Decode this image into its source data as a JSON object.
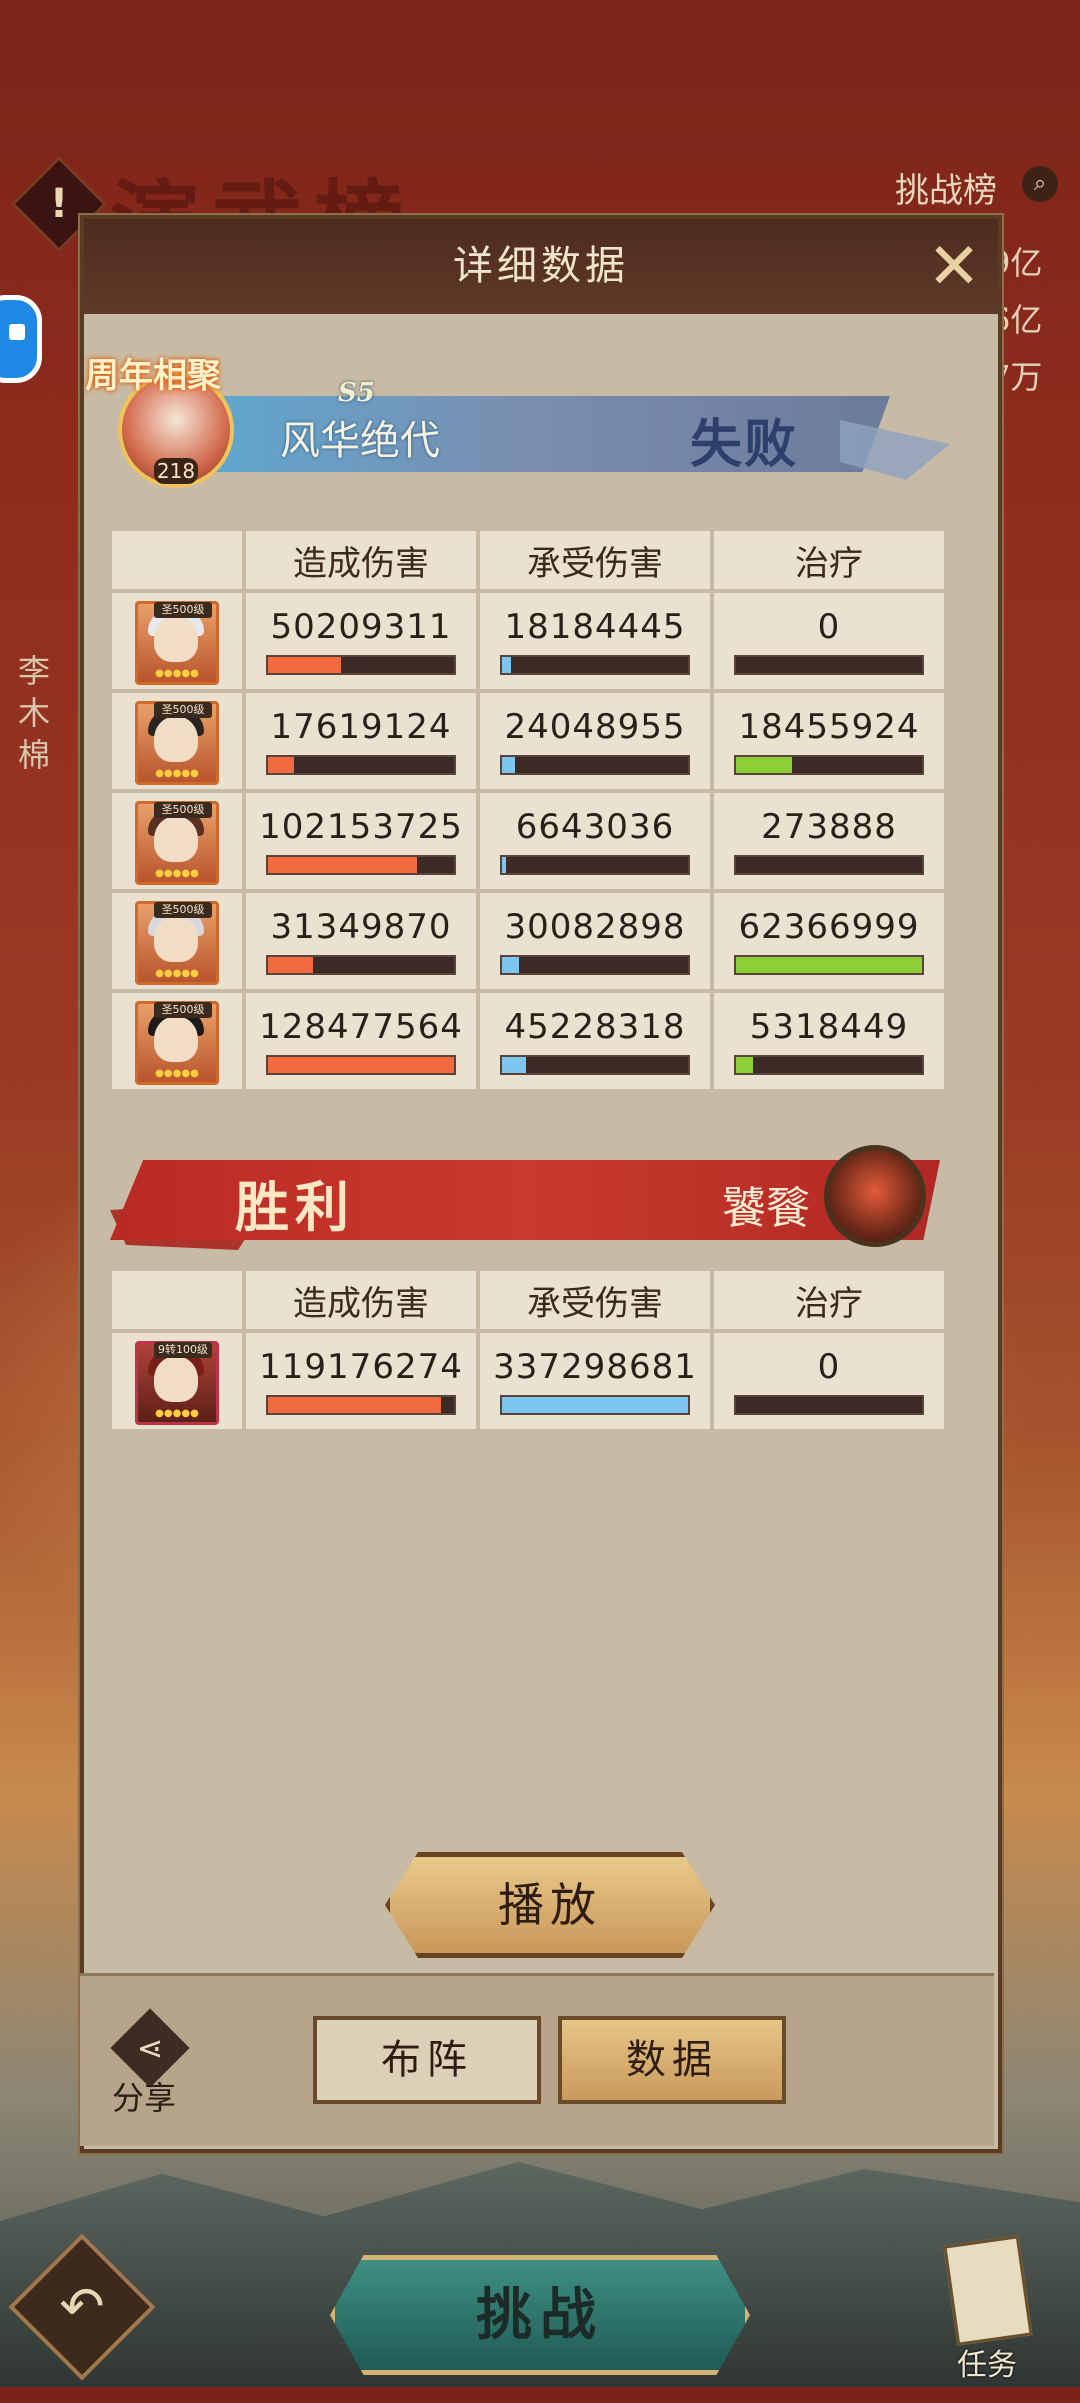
{
  "background": {
    "title": "演武榜",
    "rank_link": "挑战榜",
    "side_values": [
      "9亿",
      "6亿",
      "7万"
    ],
    "side_name": "李木棉",
    "challenge_button": "挑战",
    "task_label": "任务"
  },
  "dialog": {
    "title": "详细数据",
    "close_icon": "close-icon"
  },
  "team1": {
    "badge": "周年相聚",
    "season": "S5",
    "avatar_level": "218",
    "name": "风华绝代",
    "result": "失败",
    "columns": [
      "造成伤害",
      "承受伤害",
      "治疗"
    ],
    "rows": [
      {
        "rank": "圣500级",
        "damage": "50209311",
        "damage_pct": 39,
        "taken": "18184445",
        "taken_pct": 5,
        "heal": "0",
        "heal_pct": 0,
        "hair": "#e8e8f0"
      },
      {
        "rank": "圣500级",
        "damage": "17619124",
        "damage_pct": 14,
        "taken": "24048955",
        "taken_pct": 7,
        "heal": "18455924",
        "heal_pct": 30,
        "hair": "#2a2420"
      },
      {
        "rank": "圣500级",
        "damage": "102153725",
        "damage_pct": 80,
        "taken": "6643036",
        "taken_pct": 2,
        "heal": "273888",
        "heal_pct": 0,
        "hair": "#5a3020"
      },
      {
        "rank": "圣500级",
        "damage": "31349870",
        "damage_pct": 24,
        "taken": "30082898",
        "taken_pct": 9,
        "heal": "62366999",
        "heal_pct": 100,
        "hair": "#d8d8dc"
      },
      {
        "rank": "圣500级",
        "damage": "128477564",
        "damage_pct": 100,
        "taken": "45228318",
        "taken_pct": 13,
        "heal": "5318449",
        "heal_pct": 9,
        "hair": "#1e1a1a"
      }
    ]
  },
  "team2": {
    "result": "胜利",
    "name": "饕餮",
    "columns": [
      "造成伤害",
      "承受伤害",
      "治疗"
    ],
    "rows": [
      {
        "rank": "9转100级",
        "damage": "119176274",
        "damage_pct": 93,
        "taken": "337298681",
        "taken_pct": 100,
        "heal": "0",
        "heal_pct": 0,
        "hair": "#7a1f18"
      }
    ]
  },
  "buttons": {
    "play": "播放",
    "share": "分享",
    "formation": "布阵",
    "data": "数据"
  },
  "colors": {
    "damage_bar": "#f26a40",
    "taken_bar": "#7dc6f0",
    "heal_bar": "#8ccf38"
  }
}
